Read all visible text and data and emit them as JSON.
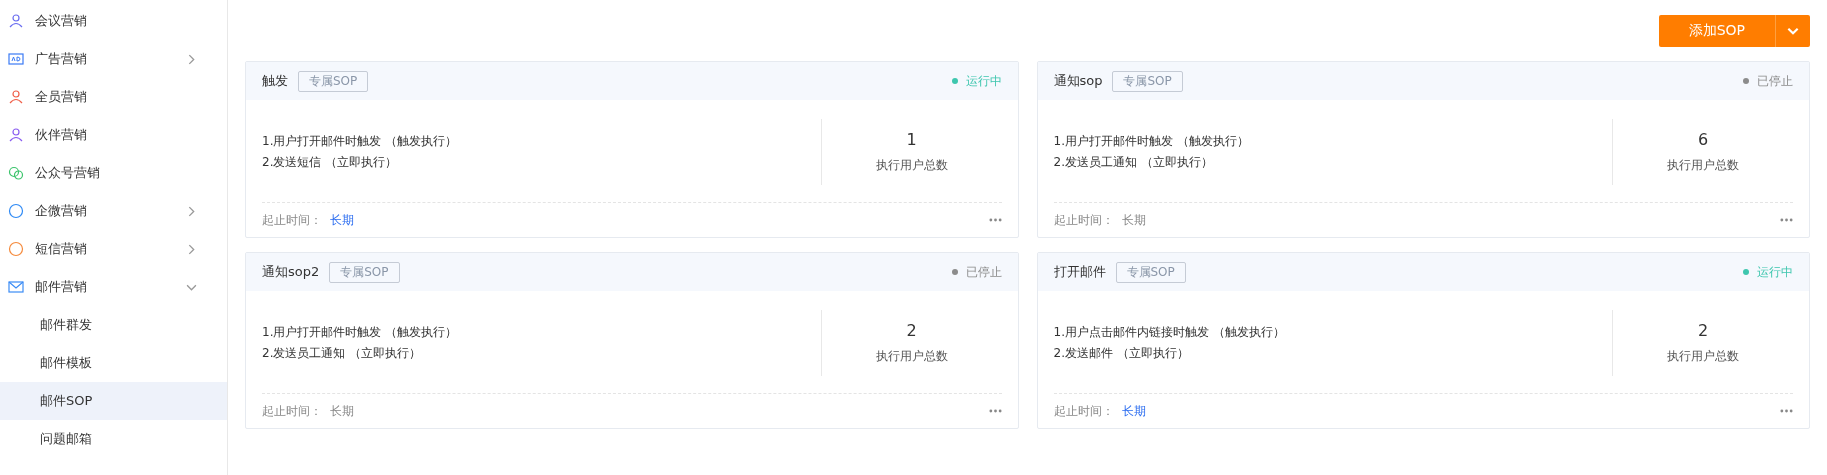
{
  "sidebar": {
    "items": [
      {
        "label": "会议营销",
        "kind": "page"
      },
      {
        "label": "广告营销",
        "kind": "group",
        "expanded": false
      },
      {
        "label": "全员营销",
        "kind": "page"
      },
      {
        "label": "伙伴营销",
        "kind": "page"
      },
      {
        "label": "公众号营销",
        "kind": "page"
      },
      {
        "label": "企微营销",
        "kind": "group",
        "expanded": false
      },
      {
        "label": "短信营销",
        "kind": "group",
        "expanded": false
      },
      {
        "label": "邮件营销",
        "kind": "group",
        "expanded": true,
        "children": [
          {
            "label": "邮件群发",
            "selected": false
          },
          {
            "label": "邮件模板",
            "selected": false
          },
          {
            "label": "邮件SOP",
            "selected": true
          },
          {
            "label": "问题邮箱",
            "selected": false
          }
        ]
      }
    ]
  },
  "add_button": {
    "label": "添加SOP"
  },
  "cards": [
    {
      "title": "触发",
      "tag": "专属SOP",
      "running": true,
      "status_label": "运行中",
      "steps": [
        "1.用户打开邮件时触发 （触发执行）",
        "2.发送短信 （立即执行）"
      ],
      "count": "1",
      "count_label": "执行用户总数",
      "period_label": "起止时间：",
      "period": "长期"
    },
    {
      "title": "通知sop",
      "tag": "专属SOP",
      "running": false,
      "status_label": "已停止",
      "steps": [
        "1.用户打开邮件时触发 （触发执行）",
        "2.发送员工通知 （立即执行）"
      ],
      "count": "6",
      "count_label": "执行用户总数",
      "period_label": "起止时间：",
      "period": "长期"
    },
    {
      "title": "通知sop2",
      "tag": "专属SOP",
      "running": false,
      "status_label": "已停止",
      "steps": [
        "1.用户打开邮件时触发 （触发执行）",
        "2.发送员工通知 （立即执行）"
      ],
      "count": "2",
      "count_label": "执行用户总数",
      "period_label": "起止时间：",
      "period": "长期"
    },
    {
      "title": "打开邮件",
      "tag": "专属SOP",
      "running": true,
      "status_label": "运行中",
      "steps": [
        "1.用户点击邮件内链接时触发 （触发执行）",
        "2.发送邮件 （立即执行）"
      ],
      "count": "2",
      "count_label": "执行用户总数",
      "period_label": "起止时间：",
      "period": "长期"
    }
  ]
}
